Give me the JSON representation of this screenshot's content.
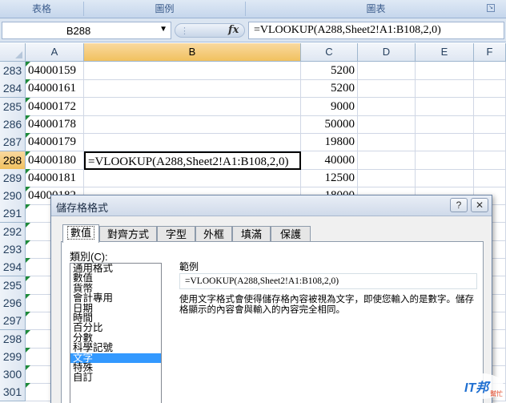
{
  "ribbon": {
    "groups": [
      "表格",
      "圖例",
      "圖表"
    ]
  },
  "formula_bar": {
    "name_box": "B288",
    "fx_label": "fx",
    "formula": "=VLOOKUP(A288,Sheet2!A1:B108,2,0)"
  },
  "columns": [
    "A",
    "B",
    "C",
    "D",
    "E",
    "F"
  ],
  "rows": [
    {
      "num": "283",
      "a": "04000159",
      "b": "",
      "c": "5200"
    },
    {
      "num": "284",
      "a": "04000161",
      "b": "",
      "c": "5200"
    },
    {
      "num": "285",
      "a": "04000172",
      "b": "",
      "c": "9000"
    },
    {
      "num": "286",
      "a": "04000178",
      "b": "",
      "c": "50000"
    },
    {
      "num": "287",
      "a": "04000179",
      "b": "",
      "c": "19800"
    },
    {
      "num": "288",
      "a": "04000180",
      "b": "=VLOOKUP(A288,Sheet2!A1:B108,2,0)",
      "c": "40000"
    },
    {
      "num": "289",
      "a": "04000181",
      "b": "",
      "c": "12500"
    },
    {
      "num": "290",
      "a": "04000182",
      "b": "",
      "c": "18000"
    },
    {
      "num": "291",
      "a": "",
      "b": "",
      "c": ""
    },
    {
      "num": "292",
      "a": "",
      "b": "",
      "c": ""
    },
    {
      "num": "293",
      "a": "",
      "b": "",
      "c": ""
    },
    {
      "num": "294",
      "a": "",
      "b": "",
      "c": ""
    },
    {
      "num": "295",
      "a": "",
      "b": "",
      "c": ""
    },
    {
      "num": "296",
      "a": "",
      "b": "",
      "c": ""
    },
    {
      "num": "297",
      "a": "",
      "b": "",
      "c": ""
    },
    {
      "num": "298",
      "a": "",
      "b": "",
      "c": ""
    },
    {
      "num": "299",
      "a": "",
      "b": "",
      "c": ""
    },
    {
      "num": "300",
      "a": "",
      "b": "",
      "c": ""
    },
    {
      "num": "301",
      "a": "",
      "b": "",
      "c": ""
    }
  ],
  "dialog": {
    "title": "儲存格格式",
    "help": "?",
    "close": "✕",
    "tabs": [
      "數值",
      "對齊方式",
      "字型",
      "外框",
      "填滿",
      "保護"
    ],
    "category_label": "類別(C):",
    "categories": [
      "通用格式",
      "數值",
      "貨幣",
      "會計專用",
      "日期",
      "時間",
      "百分比",
      "分數",
      "科學記號",
      "文字",
      "特殊",
      "自訂"
    ],
    "selected_category": "文字",
    "example_label": "範例",
    "example_value": "=VLOOKUP(A288,Sheet2!A1:B108,2,0)",
    "description": "使用文字格式會使得儲存格內容被視為文字，即使您輸入的是數字。儲存格顯示的內容會與輸入的內容完全相同。"
  },
  "watermark": {
    "text": "IT邦",
    "subtext": "幫忙"
  },
  "colors": {
    "selected_header": "#f1c15f",
    "selection_blue": "#3399ff",
    "error_triangle": "#1e8a3a"
  }
}
